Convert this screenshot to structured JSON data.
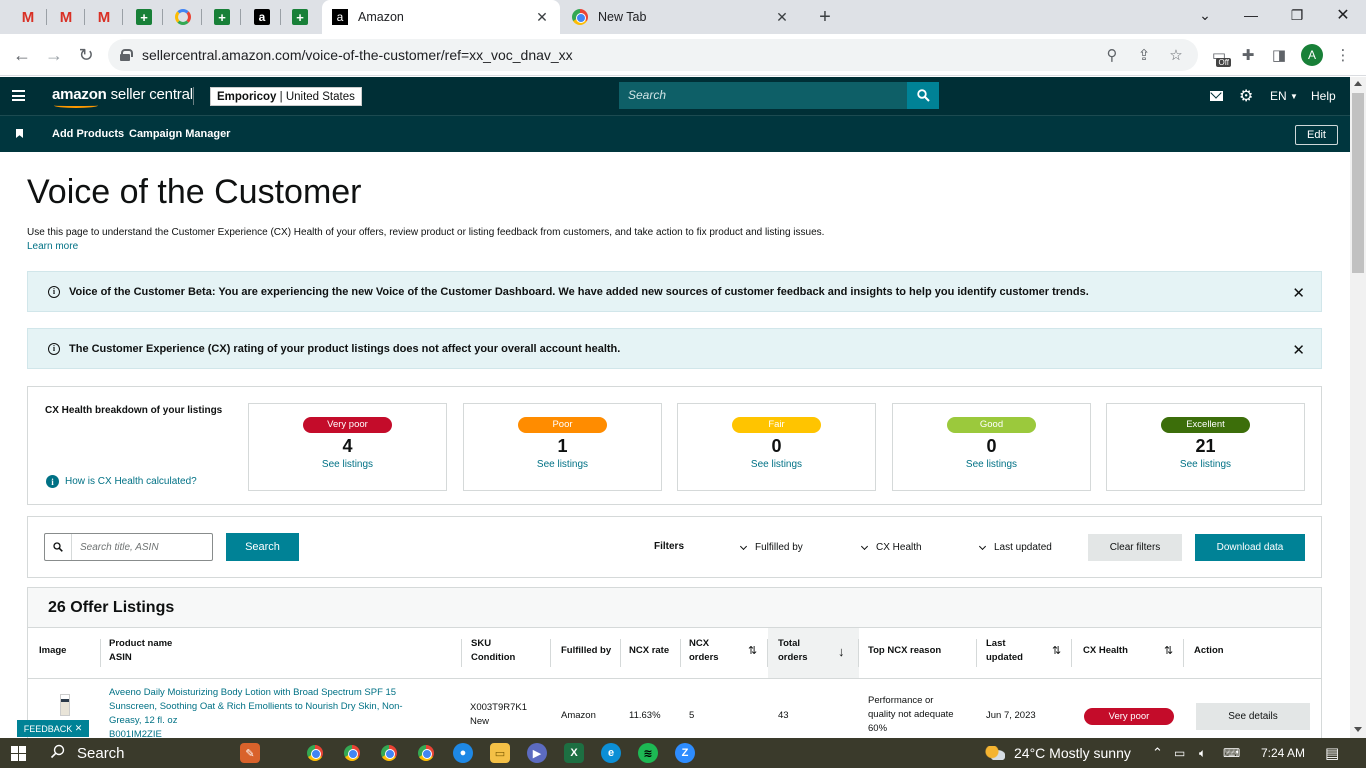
{
  "browser": {
    "pinned_tabs": [
      "gmail",
      "gmail",
      "gmail",
      "sheets",
      "google",
      "sheets",
      "amazon",
      "sheets"
    ],
    "tabs": [
      {
        "title": "Amazon",
        "active": true
      },
      {
        "title": "New Tab",
        "active": false
      }
    ],
    "url": "sellercentral.amazon.com/voice-of-the-customer/ref=xx_voc_dnav_xx",
    "profile_initial": "A",
    "ext_badge": "Off"
  },
  "header": {
    "logo_main": "amazon",
    "logo_sub": "seller central",
    "store_name": "Emporicoy",
    "store_region": "United States",
    "search_placeholder": "Search",
    "language": "EN",
    "help": "Help",
    "nav": [
      "Add Products",
      "Campaign Manager"
    ],
    "edit": "Edit"
  },
  "page": {
    "title": "Voice of the Customer",
    "intro": "Use this page to understand the Customer Experience (CX) Health of your offers, review product or listing feedback from customers, and take action to fix product and listing issues.",
    "learn_more": "Learn more",
    "alerts": [
      "Voice of the Customer Beta: You are experiencing the new Voice of the Customer Dashboard. We have added new sources of customer feedback and insights to help you identify customer trends.",
      "The Customer Experience (CX) rating of your product listings does not affect your overall account health."
    ]
  },
  "cx": {
    "label": "CX Health breakdown of your listings",
    "how": "How is CX Health calculated?",
    "see_listings": "See listings",
    "cards": [
      {
        "status": "Very poor",
        "count": "4",
        "color": "#c40c2a"
      },
      {
        "status": "Poor",
        "count": "1",
        "color": "#ff8c00"
      },
      {
        "status": "Fair",
        "count": "0",
        "color": "#ffc400"
      },
      {
        "status": "Good",
        "count": "0",
        "color": "#9bc93c"
      },
      {
        "status": "Excellent",
        "count": "21",
        "color": "#3c6e0a"
      }
    ]
  },
  "filters": {
    "search_placeholder": "Search title, ASIN",
    "search_button": "Search",
    "label": "Filters",
    "dropdowns": [
      "Fulfilled by",
      "CX Health",
      "Last updated"
    ],
    "clear": "Clear filters",
    "download": "Download data"
  },
  "listings": {
    "title": "26 Offer Listings",
    "columns": {
      "image": "Image",
      "product": "Product name",
      "asin": "ASIN",
      "sku": "SKU",
      "condition": "Condition",
      "fulfilled": "Fulfilled by",
      "ncx_rate": "NCX rate",
      "ncx_orders_1": "NCX",
      "ncx_orders_2": "orders",
      "total_1": "Total",
      "total_2": "orders",
      "top_reason": "Top NCX reason",
      "last_1": "Last",
      "last_2": "updated",
      "cx_health": "CX Health",
      "action": "Action"
    },
    "rows": [
      {
        "product_l1": "Aveeno Daily Moisturizing Body Lotion with Broad Spectrum SPF 15",
        "product_l2": "Sunscreen, Soothing Oat & Rich Emollients to Nourish Dry Skin, Non-",
        "product_l3": "Greasy, 12 fl. oz",
        "asin": "B001IM2ZIE",
        "sku": "X003T9R7K1",
        "condition": "New",
        "fulfilled": "Amazon",
        "ncx_rate": "11.63%",
        "ncx_orders": "5",
        "total_orders": "43",
        "reason_l1": "Performance or",
        "reason_l2": "quality not adequate",
        "reason_l3": "60%",
        "last_updated": "Jun 7, 2023",
        "cx_health": "Very poor",
        "action": "See details"
      }
    ]
  },
  "feedback": "FEEDBACK",
  "taskbar": {
    "search": "Search",
    "weather": "24°C  Mostly sunny",
    "time": "7:24 AM"
  }
}
